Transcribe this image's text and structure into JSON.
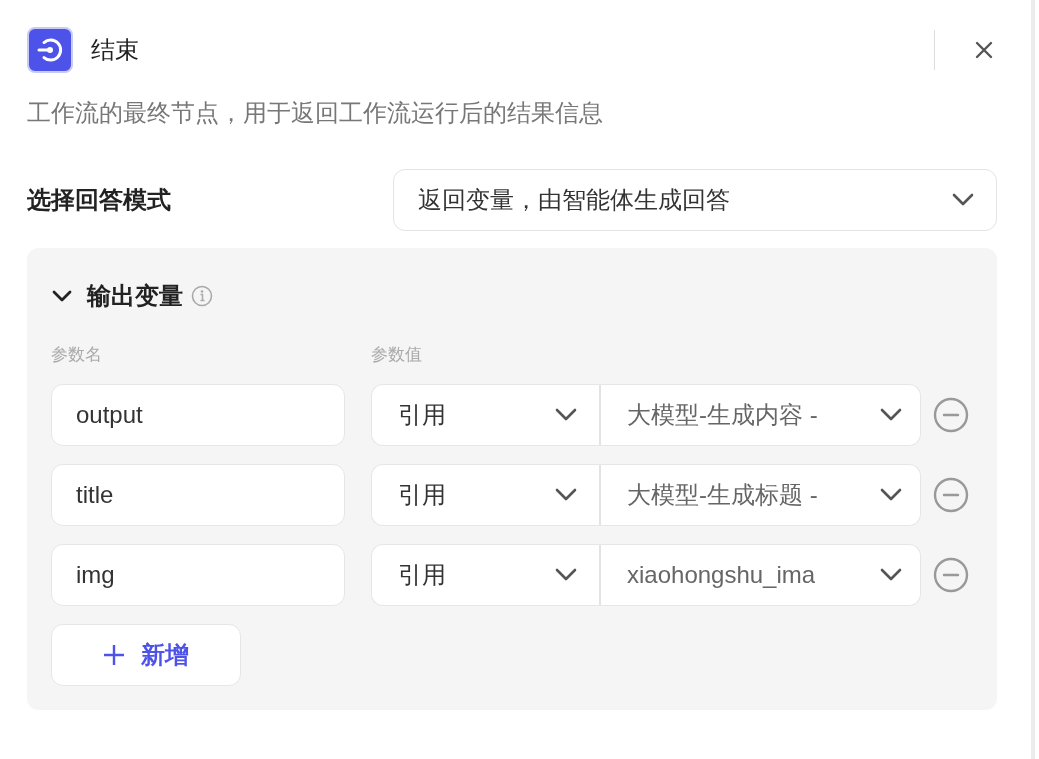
{
  "header": {
    "title": "结束",
    "description": "工作流的最终节点，用于返回工作流运行后的结果信息"
  },
  "answer_mode": {
    "label": "选择回答模式",
    "value": "返回变量，由智能体生成回答"
  },
  "output_section": {
    "title": "输出变量",
    "expanded": true,
    "columns": [
      "参数名",
      "参数值"
    ],
    "rows": [
      {
        "name": "output",
        "type": "引用",
        "value": "大模型-生成内容 -"
      },
      {
        "name": "title",
        "type": "引用",
        "value": "大模型-生成标题 -"
      },
      {
        "name": "img",
        "type": "引用",
        "value": "xiaohongshu_ima"
      }
    ],
    "add_button": "新增"
  }
}
